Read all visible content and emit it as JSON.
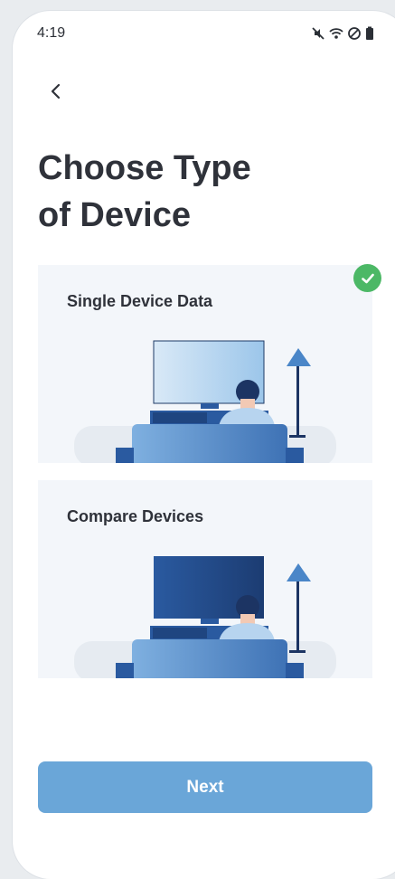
{
  "status_bar": {
    "time": "4:19",
    "icons": [
      "mute-icon",
      "wifi-icon",
      "dnd-icon",
      "battery-icon"
    ]
  },
  "title": "Choose Type of Device",
  "title_lines": [
    "Choose Type",
    "of Device"
  ],
  "options": [
    {
      "label": "Single Device Data",
      "selected": true,
      "screen_colors": [
        "#d9e9f7",
        "#9cc6ea"
      ]
    },
    {
      "label": "Compare Devices",
      "selected": false,
      "screen_colors": [
        "#2a5aa0",
        "#1c3c72"
      ]
    }
  ],
  "next_label": "Next",
  "colors": {
    "accent": "#6aa6d8",
    "check": "#4cb866",
    "card_bg": "#f3f6fa",
    "title": "#2f323a"
  }
}
